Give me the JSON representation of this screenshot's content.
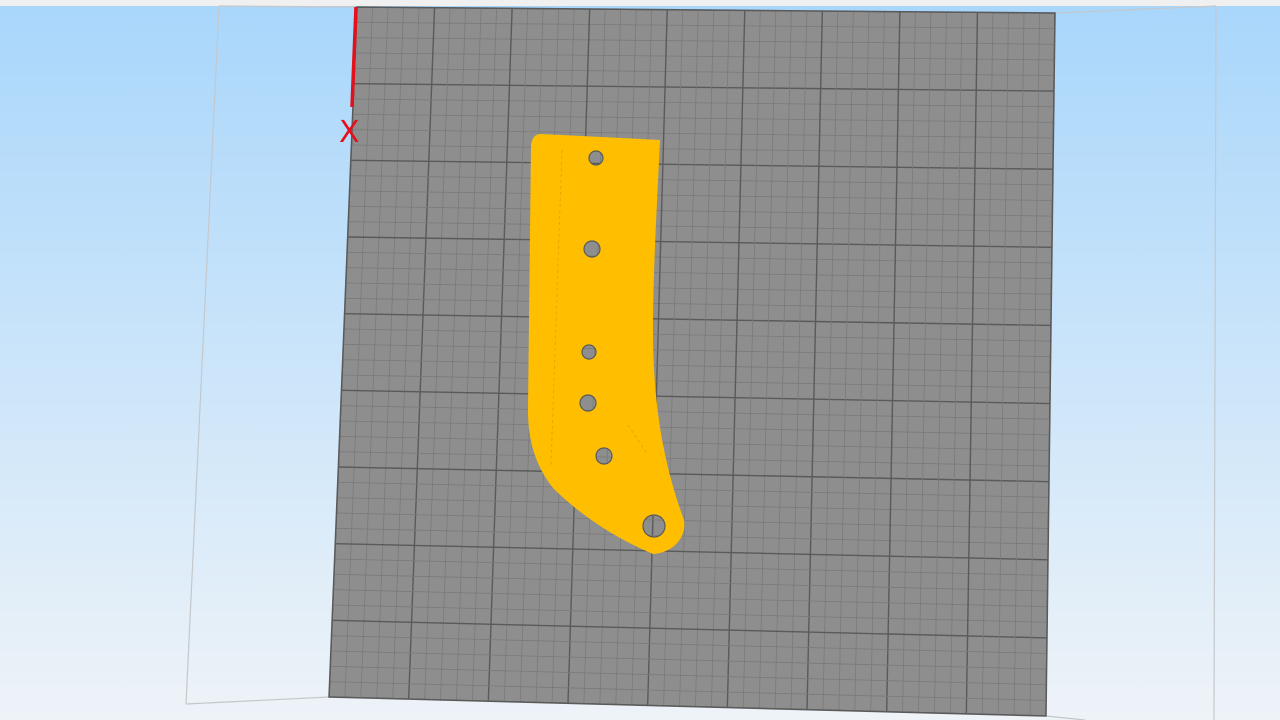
{
  "viewport": {
    "background_top": "#a8d6fb",
    "background_bottom": "#eef3f8",
    "bed_color": "#8e8e8e",
    "grid_minor_color": "#7a7a7a",
    "grid_major_color": "#5a5a5a",
    "frame_color": "#c4c8cc",
    "top_strip_color": "#f0f0f0"
  },
  "axis": {
    "label": "X",
    "color": "#e4101b"
  },
  "model": {
    "color": "#ffbf00",
    "hole_count": 6
  }
}
